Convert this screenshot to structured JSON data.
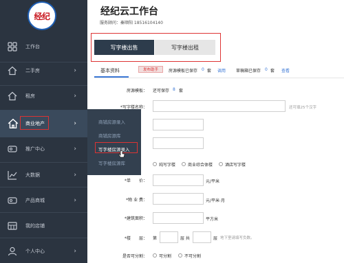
{
  "app": {
    "logo_text": "经纪",
    "title": "经纪云工作台",
    "subtitle": "服务顾问：秦顺阳 18516104140"
  },
  "sidebar": {
    "items": [
      {
        "label": "工作台",
        "icon": "dashboard-icon"
      },
      {
        "label": "二手房",
        "icon": "home-icon"
      },
      {
        "label": "租房",
        "icon": "home-icon"
      },
      {
        "label": "商业地产",
        "icon": "home-icon"
      },
      {
        "label": "推广中心",
        "icon": "card-icon"
      },
      {
        "label": "大数据",
        "icon": "chart-icon"
      },
      {
        "label": "产品商城",
        "icon": "card-icon"
      },
      {
        "label": "我的店铺",
        "icon": "grid-icon"
      },
      {
        "label": "个人中心",
        "icon": "user-icon"
      }
    ]
  },
  "flyout": {
    "items": [
      "商铺房源录入",
      "商铺房源库",
      "写字楼房源录入",
      "写字楼房源库"
    ]
  },
  "tabs": {
    "sale": "写字楼出售",
    "rent": "写字楼出租"
  },
  "section": {
    "title": "基本资料",
    "badge": "发布助手",
    "note1": "房源模板已保存",
    "note1_count": "0",
    "note1_unit": "套",
    "link1": "调用",
    "note2": "草稿箱已保存",
    "note2_count": "0",
    "note2_unit": "套",
    "link2": "查看"
  },
  "form": {
    "template_label": "房源模板：",
    "template_value": "还可保存",
    "template_count": "8",
    "template_unit": "套",
    "name_label": "*写字楼名称：",
    "name_hint": "还可填25个汉字",
    "type_options": [
      "纯写字楼",
      "商业综合体楼",
      "酒店写字楼"
    ],
    "price_label": "*单　　价：",
    "price_unit": "元/平米",
    "fee_label": "*物 业 费：",
    "fee_unit": "元/平米·月",
    "area_label": "*建筑面积：",
    "area_unit": "平方米",
    "floor_label": "*楼　　层：",
    "floor_prefix": "第",
    "floor_mid": "层 共",
    "floor_suffix": "层",
    "floor_hint": "地下室请填写负数。",
    "split_label": "是否可分割：",
    "split_options": [
      "可分割",
      "不可分割"
    ]
  },
  "colors": {
    "sidebar_bg": "#2b3440",
    "tab_active_bg": "#2d3c4c",
    "accent_blue": "#3b78d6",
    "annotation_red": "#dd3333"
  }
}
